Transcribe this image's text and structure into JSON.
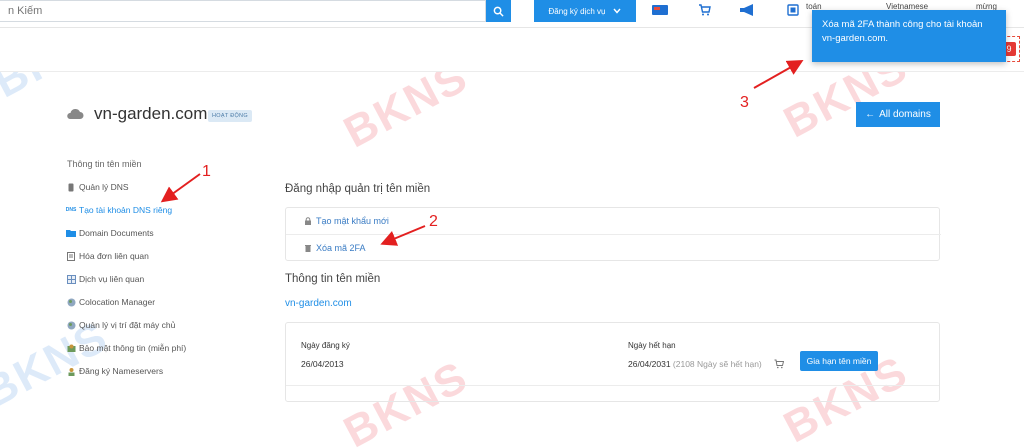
{
  "top": {
    "search_placeholder": "n Kiếm",
    "order_label": "Đăng ký dịch vụ",
    "user_text": "toán",
    "lang_text": "Vietnamese",
    "account_text": "mừng"
  },
  "toast": {
    "message": "Xóa mã 2FA thành công cho tài khoản vn-garden.com."
  },
  "domain": {
    "name": "vn-garden.com",
    "status": "HOẠT ĐỘNG",
    "all_domains": "All domains"
  },
  "sidebar": {
    "heading": "Thông tin tên miền",
    "items": [
      {
        "label": "Quản lý DNS"
      },
      {
        "label": "Tạo tài khoản DNS riêng"
      },
      {
        "label": "Domain Documents"
      },
      {
        "label": "Hóa đơn liên quan"
      },
      {
        "label": "Dịch vụ liên quan"
      },
      {
        "label": "Colocation Manager"
      },
      {
        "label": "Quản lý vị trí đặt máy chủ"
      },
      {
        "label": "Bảo mật thông tin (miễn phí)"
      },
      {
        "label": "Đăng ký Nameservers"
      }
    ]
  },
  "admin_login": {
    "title": "Đăng nhập quản trị tên miền",
    "new_password": "Tạo mật khẩu mới",
    "remove_2fa": "Xóa mã 2FA"
  },
  "domain_info": {
    "title": "Thông tin tên miền",
    "domain_link": "vn-garden.com",
    "reg_date_label": "Ngày đăng ký",
    "reg_date": "26/04/2013",
    "exp_date_label": "Ngày hết hạn",
    "exp_date": "26/04/2031",
    "exp_note": "(2108 Ngày sẽ hết hạn)",
    "renew_button": "Gia hạn tên miền"
  },
  "annotations": {
    "one": "1",
    "two": "2",
    "three": "3"
  },
  "badge_count": "9",
  "watermark": "BKNS",
  "colors": {
    "accent": "#1f8ee6",
    "annotation": "#e32020"
  }
}
